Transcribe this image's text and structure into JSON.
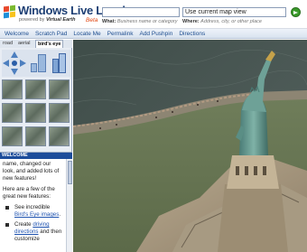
{
  "header": {
    "logo_title": "Windows Live Local",
    "logo_powered_prefix": "powered by",
    "logo_powered_brand": "Virtual Earth",
    "logo_beta": "Beta",
    "what_value": "",
    "what_label_bold": "What:",
    "what_label_hint": "Business name or category",
    "where_value": "Use current map view",
    "where_label_bold": "Where:",
    "where_label_hint": "Address, city, or other place"
  },
  "menu": {
    "items": [
      "Welcome",
      "Scratch Pad",
      "Locate Me",
      "Permalink",
      "Add Pushpin",
      "Directions"
    ]
  },
  "view_tabs": {
    "road": "road",
    "aerial": "aerial",
    "birds_eye": "bird's eye",
    "active": "bird's eye"
  },
  "welcome_panel": {
    "title": "WELCOME",
    "intro": "name, changed our look, and added lots of new features!",
    "lead": "Here are a few of the great new features:",
    "bullet1_prefix": "See incredible",
    "bullet1_link": "Bird's Eye images",
    "bullet1_suffix": ".",
    "bullet2_prefix": "Create",
    "bullet2_link": "driving directions",
    "bullet2_suffix": "and then customize"
  },
  "colors": {
    "brand_blue": "#1d3f74",
    "beta_orange": "#e14a16",
    "panel_header": "#1d4d9b",
    "link": "#1f53b0",
    "go_button": "#3a9a2a"
  }
}
